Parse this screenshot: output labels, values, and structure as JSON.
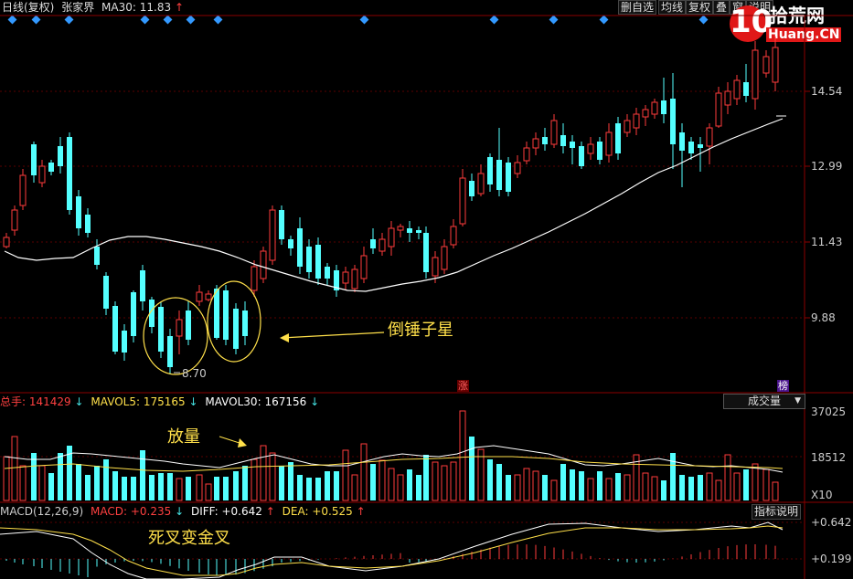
{
  "header": {
    "period": "日线(复权)",
    "stock": "张家界",
    "ma30_label": "MA30:",
    "ma30_value": "11.83",
    "ma30_arrow": "↑"
  },
  "toolbar": {
    "buttons": [
      "删自选",
      "均线",
      "复权",
      "叠",
      "窗",
      "说明"
    ]
  },
  "logo": {
    "brand_number": "10",
    "brand_cn": "拾荒网",
    "brand_en": "Huang.CN"
  },
  "price_axis": {
    "labels": [
      "14.54",
      "12.99",
      "11.43",
      "9.88"
    ]
  },
  "main_chart": {
    "low_marker": "8.70",
    "flag_up": "涨",
    "flag_rank": "榜"
  },
  "annotations": {
    "hammer": "倒锤子星",
    "volume": "放量",
    "macd": "死叉变金叉"
  },
  "volume_panel": {
    "total_label": "总手:",
    "total_value": "141429",
    "total_arrow": "↓",
    "mavol5_label": "MAVOL5:",
    "mavol5_value": "175165",
    "mavol5_arrow": "↓",
    "mavol30_label": "MAVOL30:",
    "mavol30_value": "167156",
    "mavol30_arrow": "↓",
    "selector": "成交量",
    "axis": [
      "37025",
      "18512"
    ],
    "unit": "X10"
  },
  "macd_panel": {
    "title": "MACD(12,26,9)",
    "macd_label": "MACD:",
    "macd_value": "+0.235",
    "macd_arrow": "↓",
    "diff_label": "DIFF:",
    "diff_value": "+0.642",
    "diff_arrow": "↑",
    "dea_label": "DEA:",
    "dea_value": "+0.525",
    "dea_arrow": "↑",
    "help": "指标说明",
    "axis": [
      "+0.642",
      "+0.199"
    ]
  },
  "colors": {
    "up": "#ff3c3c",
    "down": "#54ffff",
    "ma": "#ffffff",
    "ann": "#ffe04a",
    "grid": "#8b0000"
  }
}
